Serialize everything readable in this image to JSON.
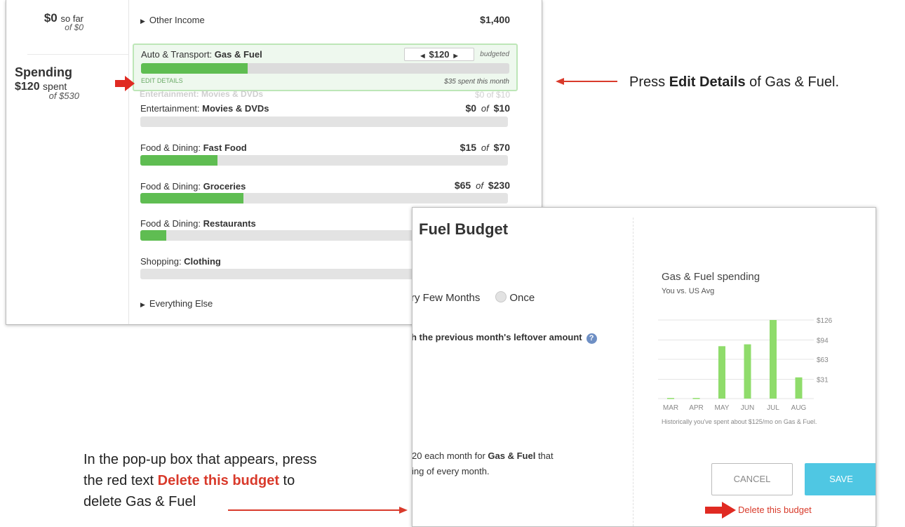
{
  "instructions": {
    "step1_before": "Press ",
    "step1_bold": "Edit Details",
    "step1_after": " of Gas & Fuel.",
    "step2_line1": "In the pop-up box that appears, press",
    "step2_line2_before": "the red text ",
    "step2_line2_red": "Delete this budget",
    "step2_line2_after": " to",
    "step2_line3": "delete Gas & Fuel"
  },
  "budget_list": {
    "income_sofar_amount": "$0",
    "income_sofar_label": "so far",
    "income_of": "of $0",
    "other_income_label": "Other Income",
    "other_income_amount": "$1,400",
    "spending_title": "Spending",
    "spending_amount": "$120",
    "spending_label": "spent",
    "spending_of": "of $530",
    "selected": {
      "category": "Auto & Transport: ",
      "name": "Gas & Fuel",
      "budget_value": "$120",
      "budgeted_label": "budgeted",
      "edit_details": "EDIT DETAILS",
      "spent_this_month": "$35 spent this month",
      "progress": 0.29
    },
    "ghost_row": {
      "label": "Entertainment: Movies & DVDs",
      "amount": "$0  of  $10"
    },
    "rows": [
      {
        "category": "Entertainment: ",
        "name": "Movies & DVDs",
        "spent": "$0",
        "of": "of",
        "budget": "$10",
        "progress": 0
      },
      {
        "category": "Food & Dining: ",
        "name": "Fast Food",
        "spent": "$15",
        "of": "of",
        "budget": "$70",
        "progress": 0.21
      },
      {
        "category": "Food & Dining: ",
        "name": "Groceries",
        "spent": "$65",
        "of": "of",
        "budget": "$230",
        "progress": 0.28
      },
      {
        "category": "Food & Dining: ",
        "name": "Restaurants",
        "progress": 0.07
      },
      {
        "category": "Shopping: ",
        "name": "Clothing",
        "progress": 0
      }
    ],
    "everything_else_label": "Everything Else"
  },
  "modal": {
    "title": "Fuel Budget",
    "freq_partial": "ry Few Months",
    "freq_once": "Once",
    "rollover_text": "h the previous month's leftover amount",
    "help_icon": "?",
    "summary_line1_before": "20 each month for ",
    "summary_line1_bold": "Gas & Fuel",
    "summary_line1_after": " that",
    "summary_line2": "ing of every month.",
    "chart_title": "Gas & Fuel spending",
    "chart_subtitle": "You vs. US Avg",
    "chart_note": "Historically you've spent about $125/mo on Gas & Fuel.",
    "cancel_label": "CANCEL",
    "save_label": "SAVE",
    "delete_label": "Delete this budget"
  },
  "chart_data": {
    "type": "bar",
    "title": "Gas & Fuel spending",
    "subtitle": "You vs. US Avg",
    "categories": [
      "MAR",
      "APR",
      "MAY",
      "JUN",
      "JUL",
      "AUG"
    ],
    "values": [
      1,
      1,
      84,
      87,
      126,
      34
    ],
    "yticks": [
      "$126",
      "$94",
      "$63",
      "$31"
    ],
    "ytick_values": [
      126,
      94,
      63,
      31
    ],
    "ylim": [
      0,
      135
    ],
    "grid": true,
    "bar_color": "#8fdc6b"
  },
  "colors": {
    "accent_green": "#5fbd52",
    "save_blue": "#4fc7e3",
    "delete_red": "#d83b2b",
    "arrow_red": "#e02a22"
  },
  "icons": {
    "expand": "triangle-right-icon",
    "decrement": "triangle-left-icon",
    "increment": "triangle-right-icon",
    "help": "question-circle-icon",
    "pointer": "red-arrow-icon"
  }
}
